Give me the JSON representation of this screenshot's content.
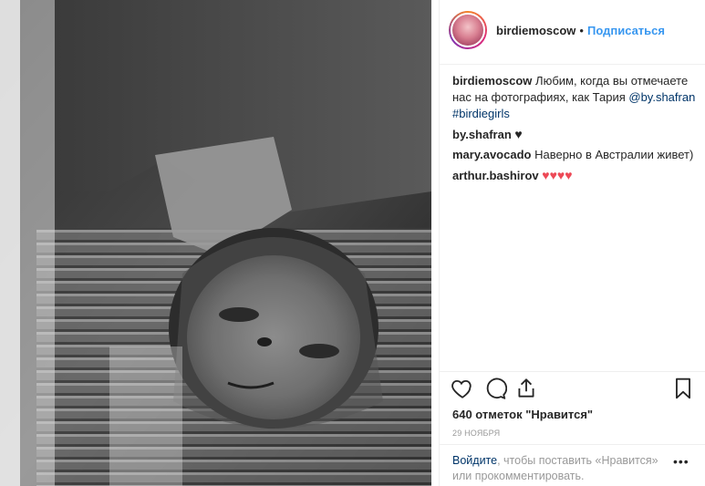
{
  "post": {
    "username": "birdiemoscow",
    "dot": "•",
    "follow_label": "Подписаться"
  },
  "caption": {
    "username": "birdiemoscow",
    "text": " Любим, когда вы отмечаете нас на фотографиях, как Тария ",
    "mention": "@by.shafran",
    "hashtag": "#birdiegirls"
  },
  "comments": [
    {
      "username": "by.shafran",
      "text": " ",
      "emoji": "♥"
    },
    {
      "username": "mary.avocado",
      "text": " Наверно в Австралии живет)"
    },
    {
      "username": "arthur.bashirov",
      "text": " ",
      "emoji": "♥♥♥♥"
    }
  ],
  "likes_text": "640 отметок \"Нравится\"",
  "date_text": "29 НОЯБРЯ",
  "login_prompt": {
    "link": "Войдите",
    "text": ", чтобы поставить «Нравится» или прокомментировать."
  },
  "more_label": "•••",
  "icons": [
    "heart-icon",
    "comment-icon",
    "share-icon",
    "bookmark-icon",
    "more-options-icon"
  ],
  "colors": {
    "follow": "#3897f0",
    "link": "#003569",
    "heart_red": "#ed4956"
  }
}
